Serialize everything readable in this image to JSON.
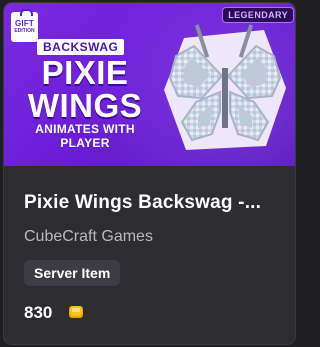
{
  "banner": {
    "gift_line1": "GIFT",
    "gift_line2": "EDITION",
    "rarity": "LEGENDARY",
    "tag": "BACKSWAG",
    "title_line1": "PIXIE",
    "title_line2": "WINGS",
    "subtitle_line1": "ANIMATES WITH",
    "subtitle_line2": "PLAYER"
  },
  "item": {
    "title": "Pixie Wings Backswag -...",
    "developer": "CubeCraft Games",
    "badge": "Server Item",
    "price": "830"
  },
  "colors": {
    "banner_purple": "#6d1fd8",
    "card_bg": "#2d2d31",
    "coin_gold": "#f5c518"
  },
  "icons": [
    "gift-icon",
    "pixie-wings-image",
    "coin-icon"
  ]
}
